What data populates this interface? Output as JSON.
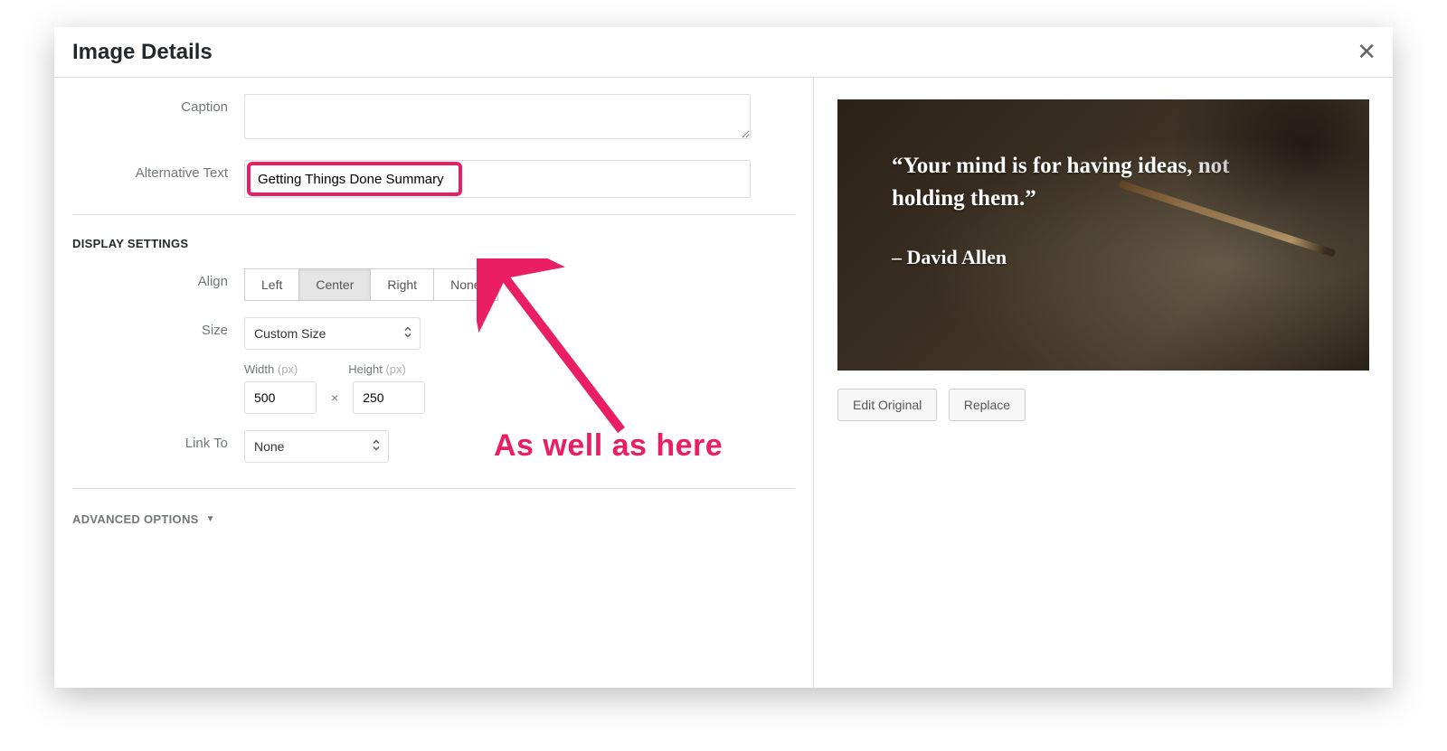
{
  "dialog": {
    "title": "Image Details"
  },
  "form": {
    "caption_label": "Caption",
    "caption_value": "",
    "alt_label": "Alternative Text",
    "alt_value": "Getting Things Done Summary"
  },
  "display_settings": {
    "heading": "DISPLAY SETTINGS",
    "align_label": "Align",
    "align_options": {
      "left": "Left",
      "center": "Center",
      "right": "Right",
      "none": "None"
    },
    "align_selected": "center",
    "size_label": "Size",
    "size_selected": "Custom Size",
    "width_label": "Width",
    "height_label": "Height",
    "px": "(px)",
    "width_value": "500",
    "height_value": "250",
    "times": "×",
    "linkto_label": "Link To",
    "linkto_selected": "None"
  },
  "advanced": {
    "label": "ADVANCED OPTIONS",
    "chevron": "▼"
  },
  "preview": {
    "quote_line1": "“Your mind is for having ideas, not",
    "quote_line2": "holding them.”",
    "author": "– David Allen",
    "edit_original": "Edit Original",
    "replace": "Replace"
  },
  "annotation": {
    "text": "As well as here"
  }
}
